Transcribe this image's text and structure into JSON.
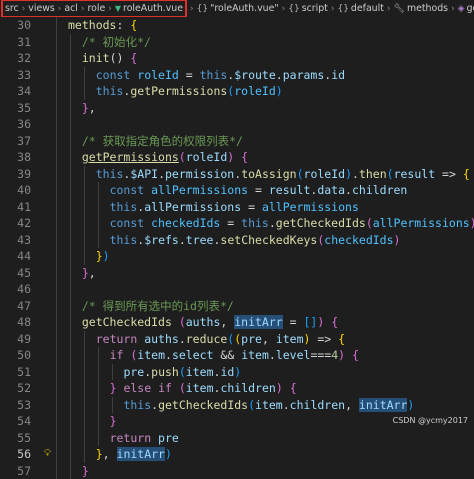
{
  "breadcrumb": {
    "highlighted": [
      "src",
      "views",
      "acl",
      "role",
      "roleAuth.vue"
    ],
    "rest": [
      {
        "icon": "braces-icon",
        "label": "\"roleAuth.vue\""
      },
      {
        "icon": "braces-icon",
        "label": "script"
      },
      {
        "icon": "braces-icon",
        "label": "default"
      },
      {
        "icon": "wrench-icon",
        "label": "methods"
      },
      {
        "icon": "cube-icon",
        "label": "getCheckedIds"
      }
    ]
  },
  "editor": {
    "current_line": 56,
    "lightbulb_line": 56,
    "lines": [
      {
        "n": 30,
        "i": 2,
        "t": [
          [
            "methods",
            "fn"
          ],
          [
            ": ",
            ""
          ],
          [
            "{",
            "br1"
          ]
        ]
      },
      {
        "n": 31,
        "i": 3,
        "t": [
          [
            "/* 初始化*/",
            "cm"
          ]
        ]
      },
      {
        "n": 32,
        "i": 3,
        "t": [
          [
            "init",
            "fn"
          ],
          [
            "() ",
            ""
          ],
          [
            "{",
            "br2"
          ]
        ]
      },
      {
        "n": 33,
        "i": 4,
        "t": [
          [
            "const ",
            "kw"
          ],
          [
            "roleId",
            "const"
          ],
          [
            " = ",
            ""
          ],
          [
            "this",
            "kw"
          ],
          [
            ".",
            ""
          ],
          [
            "$route",
            "var"
          ],
          [
            ".",
            ""
          ],
          [
            "params",
            "var"
          ],
          [
            ".",
            ""
          ],
          [
            "id",
            "var"
          ]
        ]
      },
      {
        "n": 34,
        "i": 4,
        "t": [
          [
            "this",
            "kw"
          ],
          [
            ".",
            ""
          ],
          [
            "getPermissions",
            "fn"
          ],
          [
            "(",
            "br3"
          ],
          [
            "roleId",
            "const"
          ],
          [
            ")",
            "br3"
          ]
        ]
      },
      {
        "n": 35,
        "i": 3,
        "t": [
          [
            "}",
            "br2"
          ],
          [
            ",",
            ""
          ]
        ]
      },
      {
        "n": 36,
        "i": 0,
        "t": []
      },
      {
        "n": 37,
        "i": 3,
        "t": [
          [
            "/* 获取指定角色的权限列表*/",
            "cm"
          ]
        ]
      },
      {
        "n": 38,
        "i": 3,
        "t": [
          [
            "getPermissions",
            "fnu"
          ],
          [
            "(",
            "br2"
          ],
          [
            "roleId",
            "var"
          ],
          [
            ")",
            "br2"
          ],
          [
            " ",
            ""
          ],
          [
            "{",
            "br2"
          ]
        ]
      },
      {
        "n": 39,
        "i": 4,
        "t": [
          [
            "this",
            "kw"
          ],
          [
            ".",
            ""
          ],
          [
            "$API",
            "var"
          ],
          [
            ".",
            ""
          ],
          [
            "permission",
            "var"
          ],
          [
            ".",
            ""
          ],
          [
            "toAssign",
            "fn"
          ],
          [
            "(",
            "br3"
          ],
          [
            "roleId",
            "var"
          ],
          [
            ")",
            "br3"
          ],
          [
            ".",
            ""
          ],
          [
            "then",
            "fn"
          ],
          [
            "(",
            "br3"
          ],
          [
            "result",
            "var"
          ],
          [
            " => ",
            ""
          ],
          [
            "{",
            "br1"
          ]
        ]
      },
      {
        "n": 40,
        "i": 5,
        "t": [
          [
            "const ",
            "kw"
          ],
          [
            "allPermissions",
            "const"
          ],
          [
            " = ",
            ""
          ],
          [
            "result",
            "var"
          ],
          [
            ".",
            ""
          ],
          [
            "data",
            "var"
          ],
          [
            ".",
            ""
          ],
          [
            "children",
            "var"
          ]
        ]
      },
      {
        "n": 41,
        "i": 5,
        "t": [
          [
            "this",
            "kw"
          ],
          [
            ".",
            ""
          ],
          [
            "allPermissions",
            "var"
          ],
          [
            " = ",
            ""
          ],
          [
            "allPermissions",
            "const"
          ]
        ]
      },
      {
        "n": 42,
        "i": 5,
        "t": [
          [
            "const ",
            "kw"
          ],
          [
            "checkedIds",
            "const"
          ],
          [
            " = ",
            ""
          ],
          [
            "this",
            "kw"
          ],
          [
            ".",
            ""
          ],
          [
            "getCheckedIds",
            "fn"
          ],
          [
            "(",
            "br2"
          ],
          [
            "allPermissions",
            "const"
          ],
          [
            ")",
            "br2"
          ]
        ]
      },
      {
        "n": 43,
        "i": 5,
        "t": [
          [
            "this",
            "kw"
          ],
          [
            ".",
            ""
          ],
          [
            "$refs",
            "var"
          ],
          [
            ".",
            ""
          ],
          [
            "tree",
            "var"
          ],
          [
            ".",
            ""
          ],
          [
            "setCheckedKeys",
            "fn"
          ],
          [
            "(",
            "br2"
          ],
          [
            "checkedIds",
            "const"
          ],
          [
            ")",
            "br2"
          ]
        ]
      },
      {
        "n": 44,
        "i": 4,
        "t": [
          [
            "}",
            "br1"
          ],
          [
            ")",
            "br3"
          ]
        ]
      },
      {
        "n": 45,
        "i": 3,
        "t": [
          [
            "}",
            "br2"
          ],
          [
            ",",
            ""
          ]
        ]
      },
      {
        "n": 46,
        "i": 0,
        "t": []
      },
      {
        "n": 47,
        "i": 3,
        "t": [
          [
            "/* 得到所有选中的id列表*/",
            "cm"
          ]
        ]
      },
      {
        "n": 48,
        "i": 3,
        "t": [
          [
            "getCheckedIds",
            "fn"
          ],
          [
            " ",
            ""
          ],
          [
            "(",
            "br2"
          ],
          [
            "auths",
            "var"
          ],
          [
            ", ",
            ""
          ],
          [
            "initArr",
            "varsel"
          ],
          [
            " = ",
            ""
          ],
          [
            "[",
            "br3"
          ],
          [
            "]",
            "br3"
          ],
          [
            "",
            ""
          ],
          [
            ")",
            "br2"
          ],
          [
            " ",
            ""
          ],
          [
            "{",
            "br2"
          ]
        ]
      },
      {
        "n": 49,
        "i": 4,
        "t": [
          [
            "return ",
            "ctl"
          ],
          [
            "auths",
            "var"
          ],
          [
            ".",
            ""
          ],
          [
            "reduce",
            "fn"
          ],
          [
            "(",
            "br3"
          ],
          [
            "(",
            "br1"
          ],
          [
            "pre",
            "var"
          ],
          [
            ", ",
            ""
          ],
          [
            "item",
            "var"
          ],
          [
            ")",
            "br1"
          ],
          [
            " => ",
            ""
          ],
          [
            "{",
            "br1"
          ]
        ]
      },
      {
        "n": 50,
        "i": 5,
        "t": [
          [
            "if ",
            "ctl"
          ],
          [
            "(",
            "br2"
          ],
          [
            "item",
            "var"
          ],
          [
            ".",
            ""
          ],
          [
            "select",
            "var"
          ],
          [
            " && ",
            ""
          ],
          [
            "item",
            "var"
          ],
          [
            ".",
            ""
          ],
          [
            "level",
            "var"
          ],
          [
            "===",
            ""
          ],
          [
            "4",
            "num"
          ],
          [
            ")",
            "br2"
          ],
          [
            " ",
            ""
          ],
          [
            "{",
            "br2"
          ]
        ]
      },
      {
        "n": 51,
        "i": 6,
        "t": [
          [
            "pre",
            "var"
          ],
          [
            ".",
            ""
          ],
          [
            "push",
            "fn"
          ],
          [
            "(",
            "br3"
          ],
          [
            "item",
            "var"
          ],
          [
            ".",
            ""
          ],
          [
            "id",
            "var"
          ],
          [
            ")",
            "br3"
          ]
        ]
      },
      {
        "n": 52,
        "i": 5,
        "t": [
          [
            "}",
            "br2"
          ],
          [
            " ",
            ""
          ],
          [
            "else ",
            "ctl"
          ],
          [
            "if ",
            "ctl"
          ],
          [
            "(",
            "br2"
          ],
          [
            "item",
            "var"
          ],
          [
            ".",
            ""
          ],
          [
            "children",
            "var"
          ],
          [
            ")",
            "br2"
          ],
          [
            " ",
            ""
          ],
          [
            "{",
            "br2"
          ]
        ]
      },
      {
        "n": 53,
        "i": 6,
        "t": [
          [
            "this",
            "kw"
          ],
          [
            ".",
            ""
          ],
          [
            "getCheckedIds",
            "fn"
          ],
          [
            "(",
            "br3"
          ],
          [
            "item",
            "var"
          ],
          [
            ".",
            ""
          ],
          [
            "children",
            "var"
          ],
          [
            ", ",
            ""
          ],
          [
            "initArr",
            "varsel"
          ],
          [
            ")",
            "br3"
          ]
        ]
      },
      {
        "n": 54,
        "i": 5,
        "t": [
          [
            "}",
            "br2"
          ]
        ]
      },
      {
        "n": 55,
        "i": 5,
        "t": [
          [
            "return ",
            "ctl"
          ],
          [
            "pre",
            "var"
          ]
        ]
      },
      {
        "n": 56,
        "i": 4,
        "t": [
          [
            "}",
            "br1"
          ],
          [
            ", ",
            ""
          ],
          [
            "initArr",
            "varsel"
          ],
          [
            ")",
            "br3"
          ]
        ]
      },
      {
        "n": 57,
        "i": 3,
        "t": [
          [
            "}",
            "br2"
          ]
        ]
      }
    ]
  },
  "watermark": "CSDN @ycmy2017"
}
